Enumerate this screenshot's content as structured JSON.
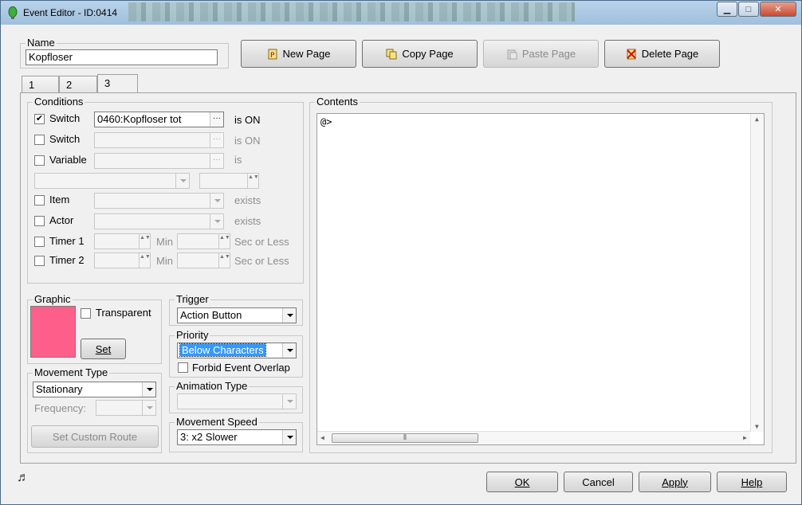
{
  "window": {
    "title": "Event Editor - ID:0414",
    "minimize_glyph": "▁",
    "maximize_glyph": "□",
    "close_glyph": "✕"
  },
  "name_group": {
    "label": "Name",
    "value": "Kopfloser"
  },
  "page_buttons": {
    "new_page": "New Page",
    "copy_page": "Copy Page",
    "paste_page": "Paste Page",
    "delete_page": "Delete Page"
  },
  "tabs": [
    {
      "label": "1"
    },
    {
      "label": "2"
    },
    {
      "label": "3"
    }
  ],
  "conditions": {
    "label": "Conditions",
    "switch1": {
      "checked_glyph": "✔",
      "label": "Switch",
      "value": "0460:Kopfloser tot",
      "state": "is ON"
    },
    "switch2": {
      "label": "Switch",
      "value": "",
      "state": "is ON"
    },
    "variable": {
      "label": "Variable",
      "value": "",
      "state": "is"
    },
    "item": {
      "label": "Item",
      "state": "exists"
    },
    "actor": {
      "label": "Actor",
      "state": "exists"
    },
    "timer1": {
      "label": "Timer 1",
      "min": "Min",
      "sec": "Sec or Less"
    },
    "timer2": {
      "label": "Timer 2",
      "min": "Min",
      "sec": "Sec or Less"
    },
    "ellipsis": "···",
    "spin_glyph": "▲▼"
  },
  "graphic": {
    "label": "Graphic",
    "transparent_label": "Transparent",
    "set_label": "Set",
    "swatch_color": "#fe5f8a"
  },
  "trigger": {
    "label": "Trigger",
    "value": "Action Button"
  },
  "priority": {
    "label": "Priority",
    "value": "Below Characters",
    "forbid_overlap_label": "Forbid Event Overlap"
  },
  "movement_type": {
    "label": "Movement Type",
    "value": "Stationary",
    "frequency_label": "Frequency:",
    "custom_route_label": "Set Custom Route"
  },
  "animation_type": {
    "label": "Animation Type",
    "value": ""
  },
  "movement_speed": {
    "label": "Movement Speed",
    "value": "3: x2 Slower"
  },
  "contents": {
    "label": "Contents",
    "lines": [
      "@>"
    ],
    "scroll_grip": "⦀"
  },
  "footer": {
    "ok": "OK",
    "cancel": "Cancel",
    "apply": "Apply",
    "help": "Help",
    "music_glyph": "♬"
  },
  "colors": {
    "selection_blue": "#3399ff",
    "close_red": "#c84a30",
    "swatch_pink": "#fe5f8a"
  }
}
